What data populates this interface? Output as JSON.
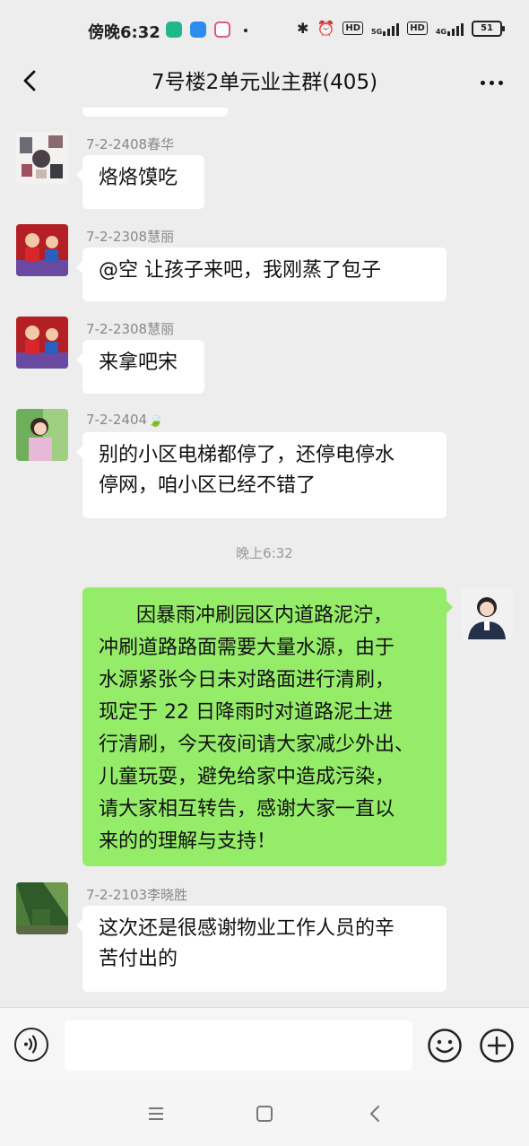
{
  "status_bar": {
    "time": "傍晚6:32",
    "network_1": "5G",
    "network_2": "4G",
    "hd_1": "HD",
    "hd_2": "HD",
    "battery": "51"
  },
  "header": {
    "title": "7号楼2单元业主群(405)"
  },
  "messages": [
    {
      "sender": "7-2-2408春华",
      "text": "烙烙馍吃"
    },
    {
      "sender": "7-2-2308慧丽",
      "text": "@空  让孩子来吧，我刚蒸了包子"
    },
    {
      "sender": "7-2-2308慧丽",
      "text": "来拿吧宋"
    },
    {
      "sender": "7-2-2404🍃",
      "lines": [
        "别的小区电梯都停了，还停电停水",
        "停网，咱小区已经不错了"
      ]
    },
    {
      "time": "晚上6:32"
    },
    {
      "self": true,
      "lines": [
        "      因暴雨冲刷园区内道路泥泞，",
        "冲刷道路路面需要大量水源，由于",
        "水源紧张今日未对路面进行清刷，",
        "现定于 22 日降雨时对道路泥土进",
        "行清刷，今天夜间请大家减少外出、",
        "儿童玩耍，避免给家中造成污染，",
        "请大家相互转告，感谢大家一直以",
        "来的的理解与支持！"
      ]
    },
    {
      "sender": "7-2-2103李晓胜",
      "lines": [
        "这次还是很感谢物业工作人员的辛",
        "苦付出的"
      ]
    }
  ],
  "icons": {
    "back": "back-arrow-icon",
    "more": "more-dots-icon",
    "voice": "voice-icon",
    "emoji": "emoji-icon",
    "plus": "plus-icon"
  },
  "colors": {
    "self_bubble": "#95ec69",
    "other_bubble": "#ffffff",
    "background": "#ededed"
  }
}
